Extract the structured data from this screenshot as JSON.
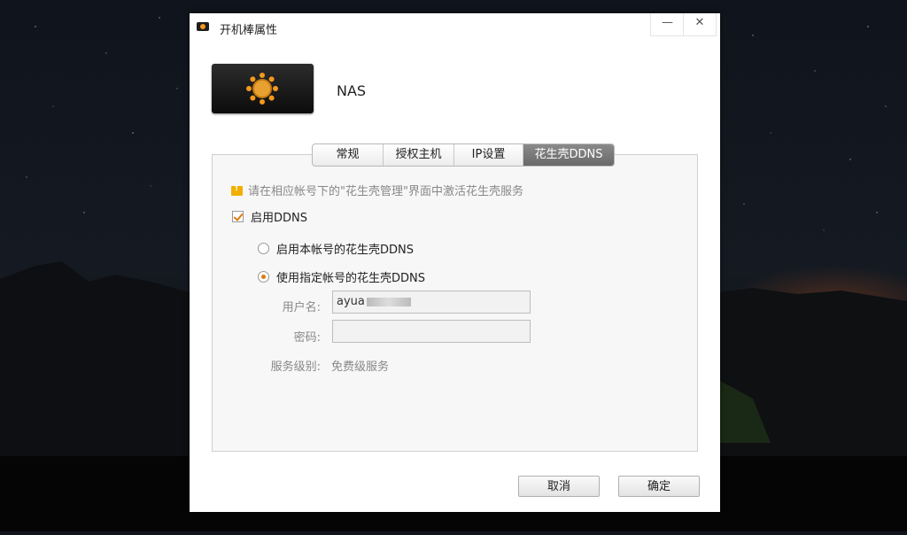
{
  "window": {
    "title": "开机棒属性",
    "minimize": "—",
    "close": "✕"
  },
  "device": {
    "name": "NAS"
  },
  "tabs": [
    {
      "label": "常规"
    },
    {
      "label": "授权主机"
    },
    {
      "label": "IP设置"
    },
    {
      "label": "花生壳DDNS",
      "active": true
    }
  ],
  "notice": "请在相应帐号下的\"花生壳管理\"界面中激活花生壳服务",
  "enable_ddns": {
    "label": "启用DDNS",
    "checked": true
  },
  "options": [
    {
      "label": "启用本帐号的花生壳DDNS",
      "selected": false
    },
    {
      "label": "使用指定帐号的花生壳DDNS",
      "selected": true
    }
  ],
  "form": {
    "username_label": "用户名:",
    "username_value": "ayua",
    "password_label": "密码:",
    "password_value": "",
    "level_label": "服务级别:",
    "level_value": "免费级服务"
  },
  "buttons": {
    "cancel": "取消",
    "ok": "确定"
  },
  "colors": {
    "accent": "#e07a10",
    "tab_active": "#7a7a7a"
  },
  "icons": [
    "app-icon",
    "sunflower-logo-icon",
    "warning-icon",
    "check-icon",
    "radio-icon"
  ]
}
